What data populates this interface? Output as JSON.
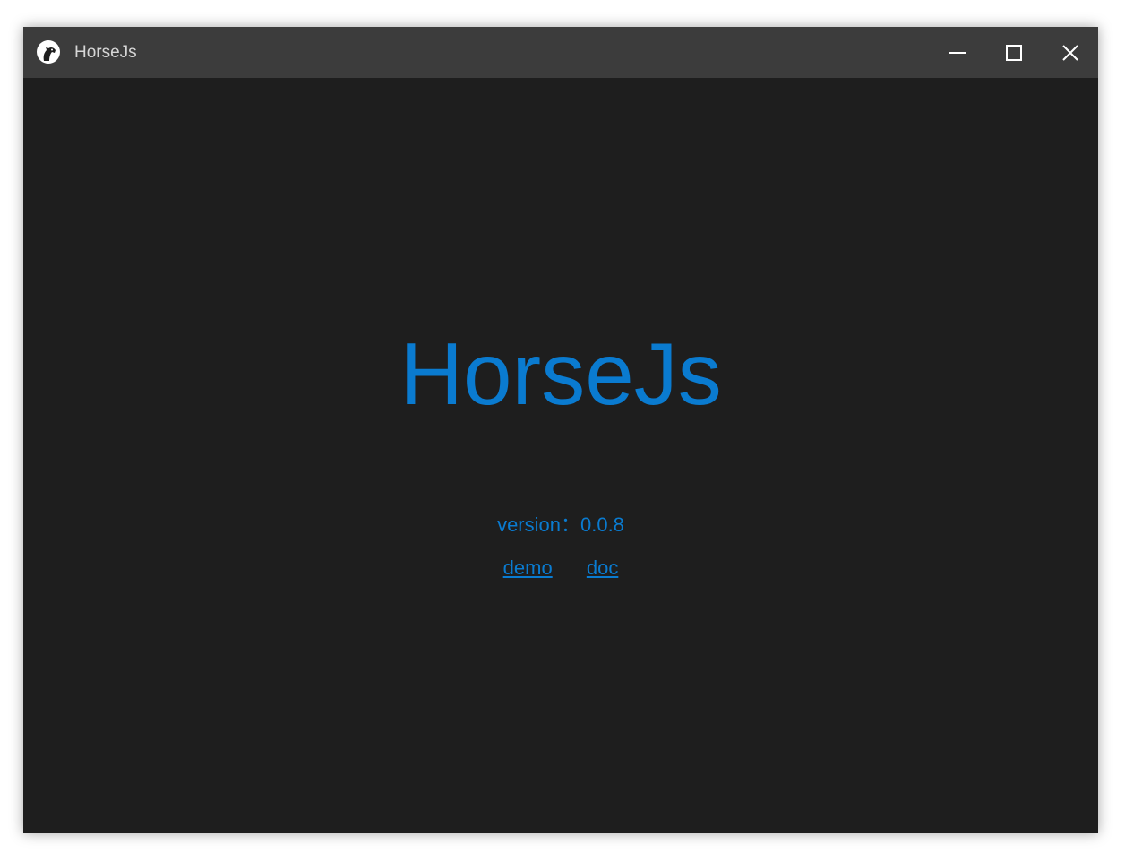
{
  "window": {
    "title": "HorseJs",
    "controls": {
      "minimize_icon": "minimize-icon",
      "maximize_icon": "maximize-icon",
      "close_icon": "close-icon"
    }
  },
  "main": {
    "title": "HorseJs",
    "version_label": "version：",
    "version_value": "0.0.8",
    "links": [
      {
        "label": "demo"
      },
      {
        "label": "doc"
      }
    ]
  },
  "colors": {
    "accent": "#0a7bd0",
    "background": "#1e1e1e",
    "titlebar": "#3c3c3c",
    "title_text": "#d6d6d6"
  }
}
